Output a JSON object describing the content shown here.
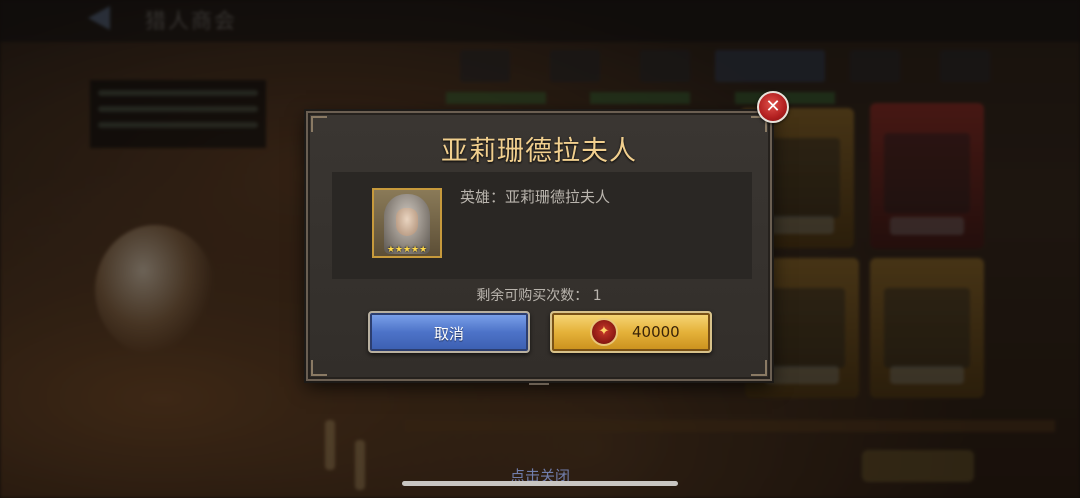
{
  "background": {
    "screen_title": "猎人商会",
    "tap_to_close": "点击关闭"
  },
  "dialog": {
    "title": "亚莉珊德拉夫人",
    "hero_label": "英雄：亚莉珊德拉夫人",
    "hero_stars": "★★★★★",
    "remaining_purchases": "剩余可购买次数： 1",
    "cancel_label": "取消",
    "price": "40000",
    "close_symbol": "✕",
    "currency_symbol": "✦"
  },
  "colors": {
    "title": "#f1cf8e",
    "cancel_button": "#4d73c8",
    "buy_button": "#e5b23a",
    "close_button": "#b11f1f"
  },
  "icons": {
    "close": "close-icon",
    "currency": "red-gem-coin-icon"
  }
}
